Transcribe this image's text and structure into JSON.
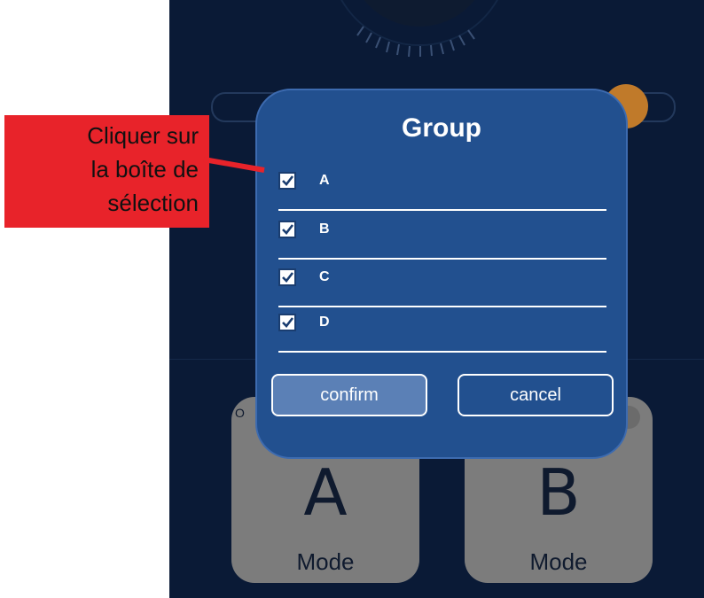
{
  "dialog": {
    "title": "Group",
    "items": [
      {
        "label": "A",
        "checked": true
      },
      {
        "label": "B",
        "checked": true
      },
      {
        "label": "C",
        "checked": true
      },
      {
        "label": "D",
        "checked": true
      }
    ],
    "confirm_label": "confirm",
    "cancel_label": "cancel"
  },
  "background": {
    "tile_a": {
      "letter": "A",
      "label": "Mode"
    },
    "tile_b": {
      "letter": "B",
      "label": "Mode"
    },
    "tile_a_corner": "O"
  },
  "annotation": {
    "text_lines": [
      "Cliquer sur",
      "la boîte de",
      "sélection"
    ]
  },
  "colors": {
    "screen_bg": "#0a1a36",
    "dialog_bg": "#22508f",
    "confirm_bg": "#5b80b6",
    "callout_bg": "#e8232a",
    "knob": "#c07a2a",
    "tile": "#7c7c7c"
  }
}
